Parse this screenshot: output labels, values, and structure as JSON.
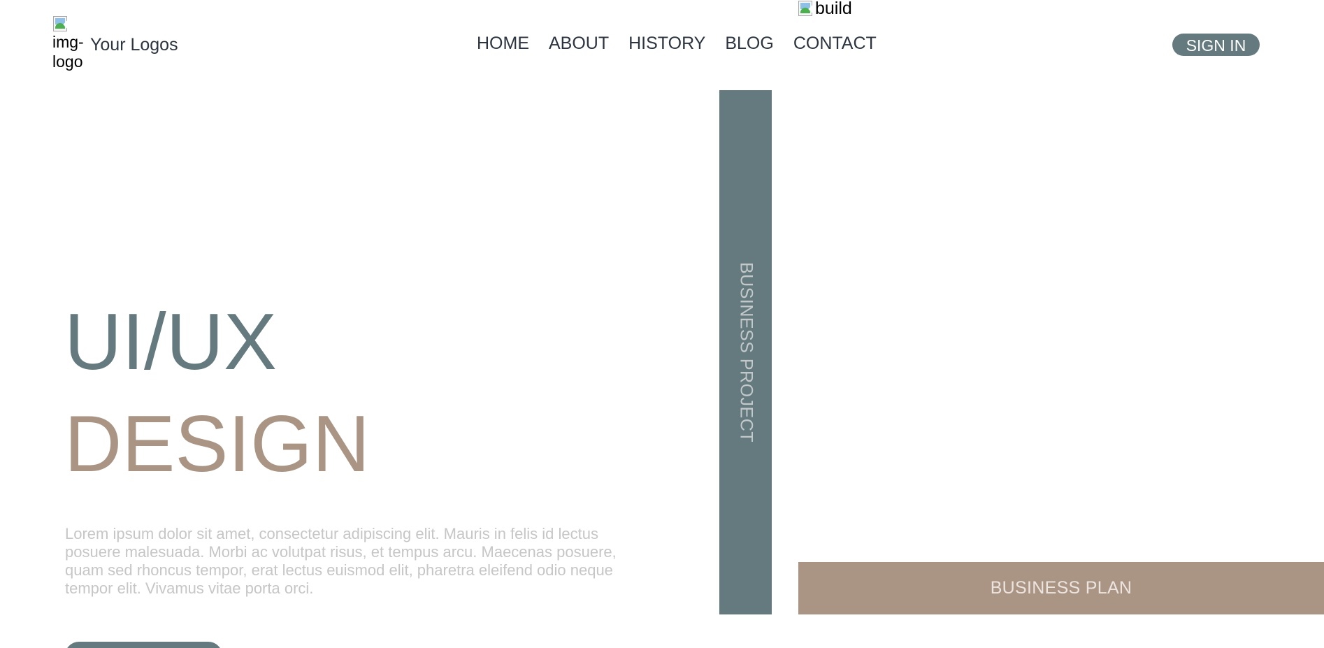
{
  "header": {
    "logo_alt": "img-logo",
    "brand": "Your Logos",
    "build_image_alt": "build",
    "nav": [
      "HOME",
      "ABOUT",
      "HISTORY",
      "BLOG",
      "CONTACT"
    ],
    "signin_label": "SIGN IN"
  },
  "hero": {
    "title_line_1": "UI/UX",
    "title_line_2": "DESIGN",
    "description": "Lorem ipsum dolor sit amet, consectetur adipiscing elit. Mauris in felis id lectus posuere malesuada. Morbi ac volutpat risus, et tempus arcu. Maecenas posuere, quam sed rhoncus tempor, erat lectus euismod elit, pharetra eleifend odio neque tempor elit. Vivamus vitae porta orci."
  },
  "side": {
    "project_label": "BUSINESS PROJECT",
    "plan_label": "BUSINESS PLAN"
  },
  "icons": {
    "logo": "broken-image-icon",
    "build": "broken-image-icon"
  },
  "colors": {
    "primary": "#647a7e",
    "accent": "#aa9585",
    "text": "#2c3440",
    "muted": "#c6c6c6"
  }
}
